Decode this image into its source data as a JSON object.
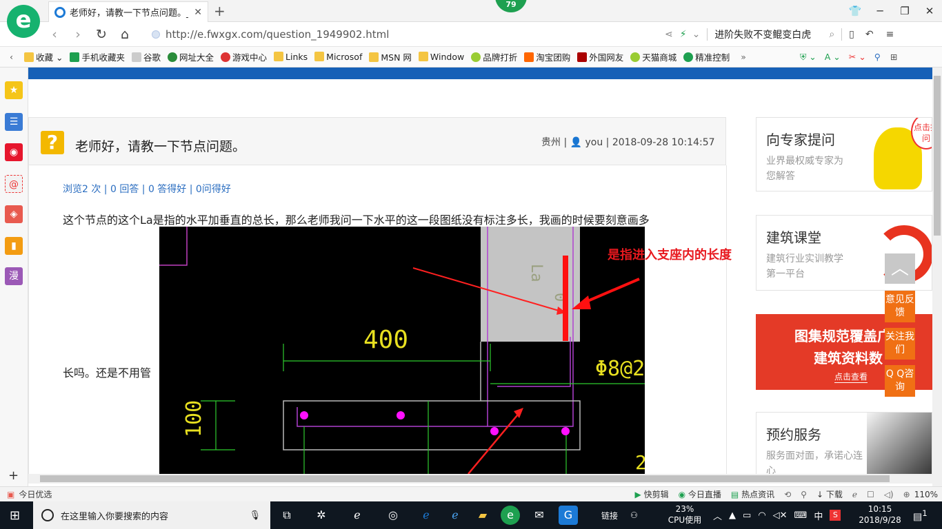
{
  "tab": {
    "title": "老师好，请教一下节点问题。_广",
    "badge": "79"
  },
  "address": {
    "url": "http://e.fwxgx.com/question_1949902.html",
    "search_hint": "进阶失败不变鲲变白虎"
  },
  "bookmarks": [
    "收藏",
    "手机收藏夹",
    "谷歌",
    "网址大全",
    "游戏中心",
    "Links",
    "Microsof",
    "MSN 网",
    "Window",
    "品牌打折",
    "淘宝团购",
    "外国网友",
    "天猫商城",
    "精准控制"
  ],
  "question": {
    "title": "老师好，请教一下节点问题。",
    "meta": "贵州 | 👤 you | 2018-09-28 10:14:57",
    "stats": "浏览2 次 | 0 回答 | 0 答得好 | 0问得好",
    "body_line1": "这个节点的这个La是指的水平加垂直的总长，那么老师我问一下水平的这一段图纸没有标注多长，我画的时候要刻意画多",
    "body_line2": "长吗。还是不用管"
  },
  "cad": {
    "caption": "是指进入支座内的长度",
    "dim_top": "400",
    "dim_left": "100",
    "rebar_label": "Φ8@2",
    "vert_label_1": "La",
    "vert_label_2": "0",
    "num_bottom": "2"
  },
  "sidebar_right": {
    "card1": {
      "title": "向专家提问",
      "sub": "业界最权威专家为您解答",
      "bubble": "点击提问"
    },
    "card2": {
      "title": "建筑课堂",
      "sub": "建筑行业实训教学第一平台"
    },
    "banner": {
      "line1": "图集规范覆盖广",
      "line2": "建筑资料数",
      "cta": "点击查看"
    },
    "card3": {
      "title": "预约服务",
      "sub": "服务面对面，承诺心连心"
    },
    "float_buttons": [
      "意见反馈",
      "关注我们",
      "Q Q咨询"
    ]
  },
  "statusbar": {
    "left": "今日优选",
    "items": [
      "快剪辑",
      "今日直播",
      "热点资讯",
      "下载"
    ],
    "zoom": "110%"
  },
  "taskbar": {
    "search_placeholder": "在这里输入你要搜索的内容",
    "link_label": "链接",
    "cpu_percent": "23%",
    "cpu_label": "CPU使用",
    "ime": "中",
    "time": "10:15",
    "date": "2018/9/28",
    "notifications": "1"
  }
}
